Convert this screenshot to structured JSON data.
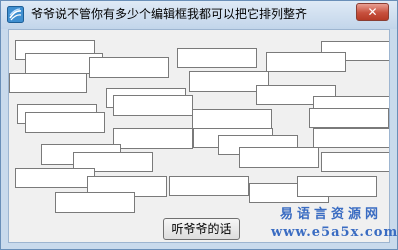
{
  "window": {
    "title": "爷爷说不管你有多少个编辑框我都可以把它排列整齐",
    "close_glyph": "✕",
    "icon": "app-icon"
  },
  "button": {
    "label": "听爷爷的话"
  },
  "watermark": {
    "line1": "易语言资源网",
    "line2": "www.e5a5x.com"
  },
  "edit_box_count": 30
}
